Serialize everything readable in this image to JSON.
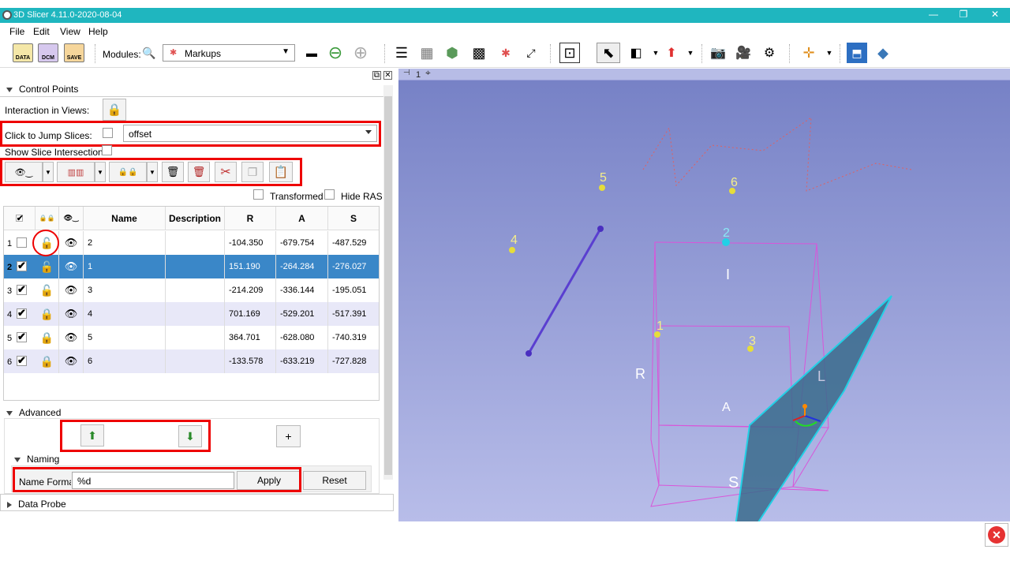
{
  "window": {
    "title": "3D Slicer 4.11.0-2020-08-04"
  },
  "menu": {
    "file": "File",
    "edit": "Edit",
    "view": "View",
    "help": "Help"
  },
  "toolbar": {
    "data_label": "DATA",
    "dcm_label": "DCM",
    "save_label": "SAVE",
    "modules_label": "Modules:",
    "module_selected": "Markups"
  },
  "control_points": {
    "section_label": "Control Points",
    "interaction_label": "Interaction in Views:",
    "jump_slices_label": "Click to Jump Slices:",
    "jump_mode": "offset",
    "show_slice_intersections_label": "Show Slice Intersections:",
    "transformed_label": "Transformed",
    "hide_ras_label": "Hide RAS"
  },
  "table": {
    "headers": {
      "name": "Name",
      "description": "Description",
      "r": "R",
      "a": "A",
      "s": "S"
    },
    "rows": [
      {
        "num": "1",
        "checked": false,
        "name": "2",
        "description": "",
        "r": "-104.350",
        "a": "-679.754",
        "s": "-487.529",
        "locked": "unlocked"
      },
      {
        "num": "2",
        "checked": true,
        "name": "1",
        "description": "",
        "r": "151.190",
        "a": "-264.284",
        "s": "-276.027",
        "locked": "unlocked"
      },
      {
        "num": "3",
        "checked": true,
        "name": "3",
        "description": "",
        "r": "-214.209",
        "a": "-336.144",
        "s": "-195.051",
        "locked": "unlocked"
      },
      {
        "num": "4",
        "checked": true,
        "name": "4",
        "description": "",
        "r": "701.169",
        "a": "-529.201",
        "s": "-517.391",
        "locked": "locked"
      },
      {
        "num": "5",
        "checked": true,
        "name": "5",
        "description": "",
        "r": "364.701",
        "a": "-628.080",
        "s": "-740.319",
        "locked": "locked"
      },
      {
        "num": "6",
        "checked": true,
        "name": "6",
        "description": "",
        "r": "-133.578",
        "a": "-633.219",
        "s": "-727.828",
        "locked": "locked"
      }
    ]
  },
  "advanced": {
    "section_label": "Advanced",
    "naming_label": "Naming",
    "name_format_label": "Name Format",
    "name_format_value": "%d",
    "apply_label": "Apply",
    "reset_label": "Reset"
  },
  "data_probe": {
    "section_label": "Data Probe"
  },
  "viewport": {
    "view_label": "1",
    "point_labels": [
      "5",
      "6",
      "4",
      "2",
      "1",
      "3"
    ],
    "orientation_labels": {
      "r": "R",
      "l": "L",
      "a": "A",
      "s": "S",
      "i": "I"
    }
  }
}
